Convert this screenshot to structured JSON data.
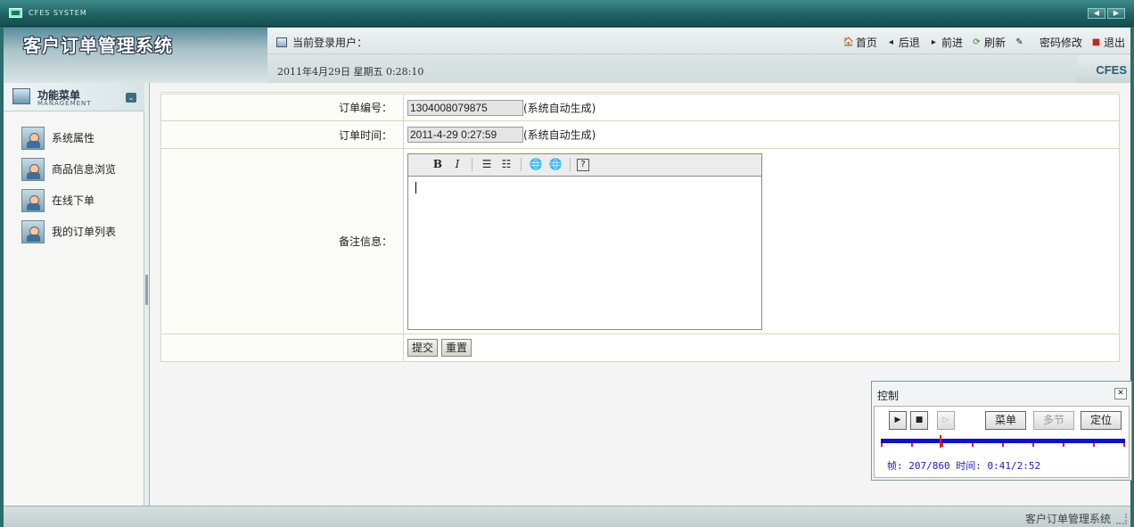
{
  "window": {
    "title": "CFES SYSTEM"
  },
  "header": {
    "system_title": "客户订单管理系统",
    "current_user_label": "当前登录用户：",
    "datetime": "2011年4月29日  星期五  0:28:10",
    "brand": "CFES",
    "nav": {
      "home": "首页",
      "back": "后退",
      "forward": "前进",
      "refresh": "刷新",
      "change_password": "密码修改",
      "logout": "退出"
    }
  },
  "sidebar": {
    "title": "功能菜单",
    "subtitle": "MANAGEMENT",
    "items": [
      {
        "label": "系统属性"
      },
      {
        "label": "商品信息浏览"
      },
      {
        "label": "在线下单"
      },
      {
        "label": "我的订单列表"
      }
    ]
  },
  "form": {
    "order_no_label": "订单编号：",
    "order_no_value": "1304008079875",
    "order_no_hint": "(系统自动生成)",
    "order_time_label": "订单时间：",
    "order_time_value": "2011-4-29 0:27:59",
    "order_time_hint": "(系统自动生成)",
    "remark_label": "备注信息：",
    "remark_value": "",
    "submit": "提交",
    "reset": "重置"
  },
  "editor_toolbar": {
    "bold": "B",
    "italic": "I",
    "help": "?"
  },
  "control": {
    "title": "控制",
    "close": "x",
    "menu": "菜单",
    "multi": "多节",
    "locate": "定位",
    "status": "帧: 207/860  时间: 0:41/2:52",
    "progress": 0.24
  },
  "footer": {
    "text": "客户订单管理系统"
  },
  "colors": {
    "accent": "#2a6e6e",
    "progress_track": "#1010d0",
    "marker": "#e02020"
  }
}
